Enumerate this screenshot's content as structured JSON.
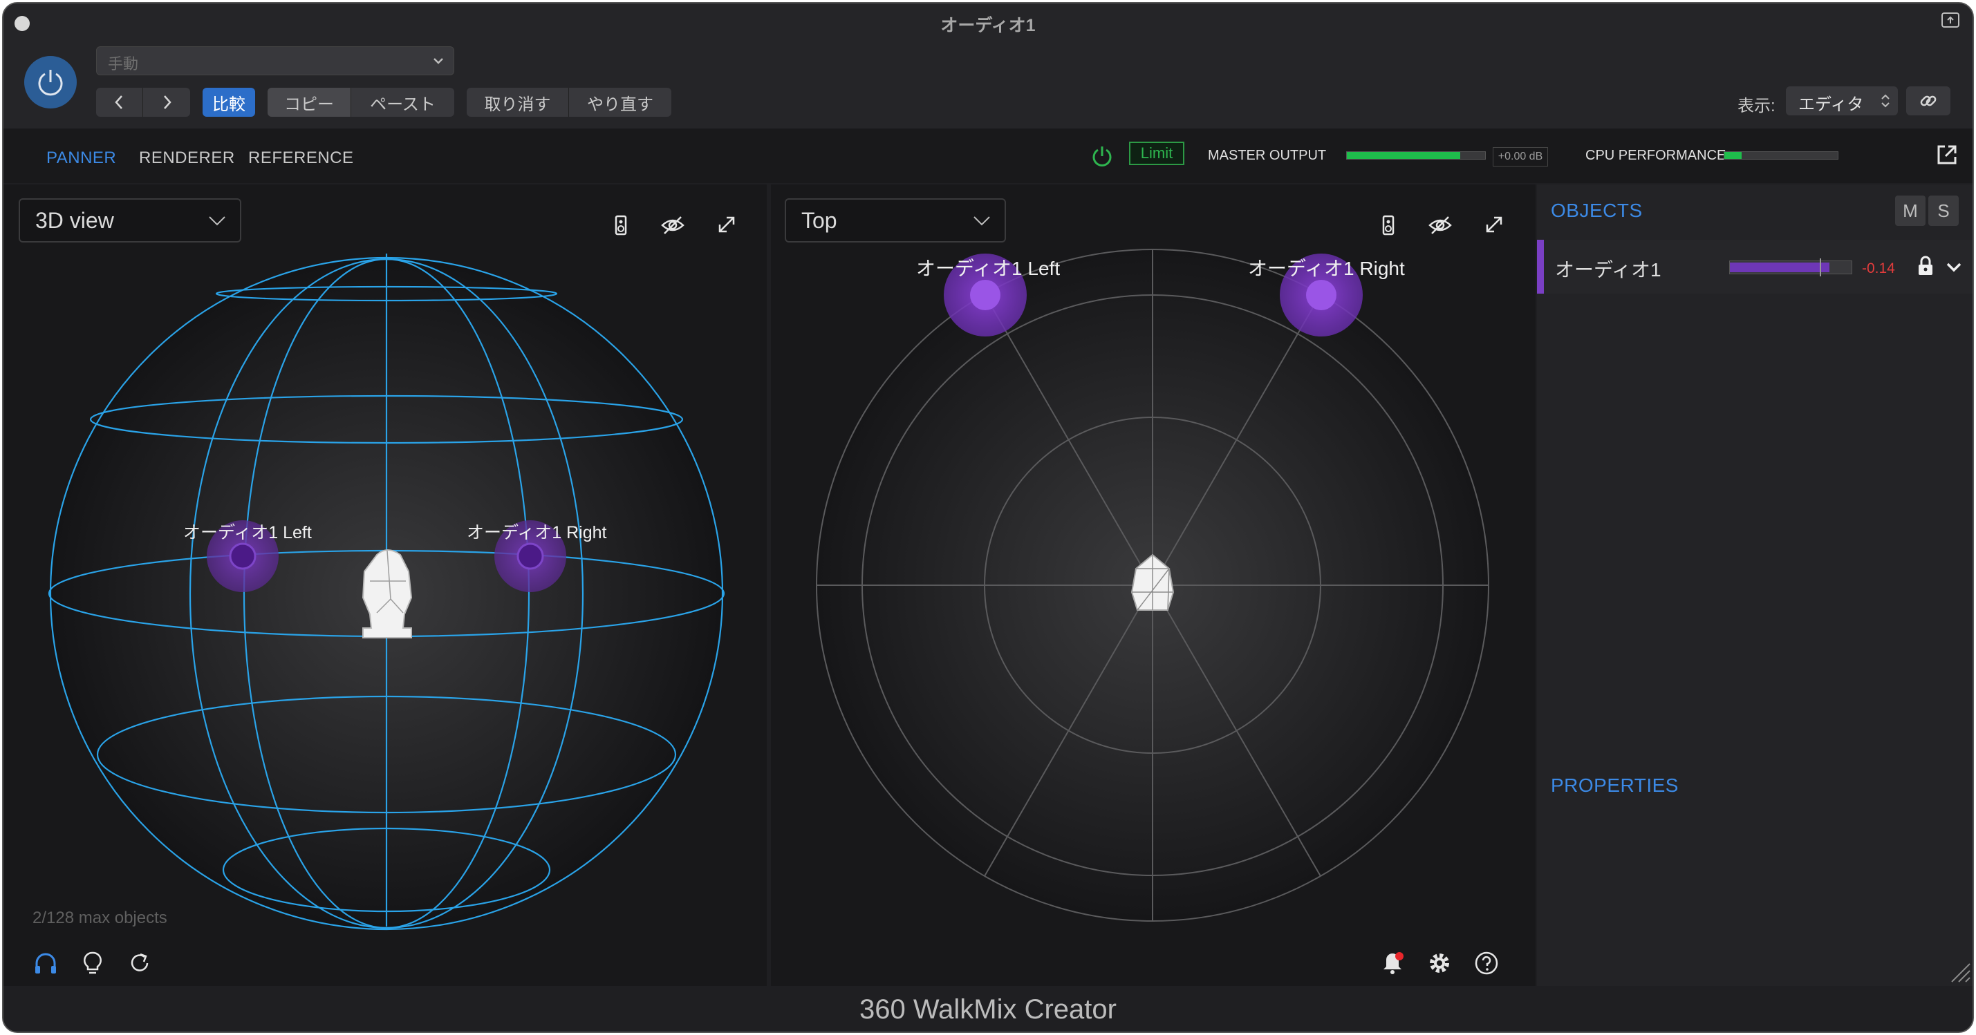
{
  "window": {
    "title": "オーディオ1"
  },
  "host_toolbar": {
    "preset_placeholder": "手動",
    "compare_label": "比較",
    "copy_label": "コピー",
    "paste_label": "ペースト",
    "undo_label": "取り消す",
    "redo_label": "やり直す",
    "view_label": "表示:",
    "view_value": "エディタ"
  },
  "plugin_header": {
    "tabs": [
      {
        "label": "PANNER",
        "active": true
      },
      {
        "label": "RENDERER",
        "active": false
      },
      {
        "label": "REFERENCE",
        "active": false
      }
    ],
    "limit_label": "Limit",
    "master_output_label": "MASTER OUTPUT",
    "master_output_level": 0.82,
    "master_output_db": "+0.00 dB",
    "cpu_label": "CPU PERFORMANCE",
    "cpu_level": 0.15
  },
  "view3d": {
    "mode": "3D view",
    "max_objects_text": "2/128 max objects",
    "objects": [
      {
        "label": "オーディオ1 Left",
        "color": "#6a2fb0"
      },
      {
        "label": "オーディオ1 Right",
        "color": "#6a2fb0"
      }
    ]
  },
  "viewtop": {
    "mode": "Top",
    "objects": [
      {
        "label": "オーディオ1 Left",
        "color": "#7d3cc8"
      },
      {
        "label": "オーディオ1 Right",
        "color": "#7d3cc8"
      }
    ]
  },
  "sidebar": {
    "objects_title": "OBJECTS",
    "mute_label": "M",
    "solo_label": "S",
    "object_row": {
      "name": "オーディオ1",
      "level": 0.82,
      "db": "-0.14"
    },
    "properties_title": "PROPERTIES"
  },
  "footer": {
    "brand": "360 WalkMix Creator"
  },
  "colors": {
    "accent": "#3c8ae6",
    "sphere_lines": "#2aa3e8",
    "object_purple": "#7d3cc8",
    "meter_green": "#1fbd4c"
  }
}
